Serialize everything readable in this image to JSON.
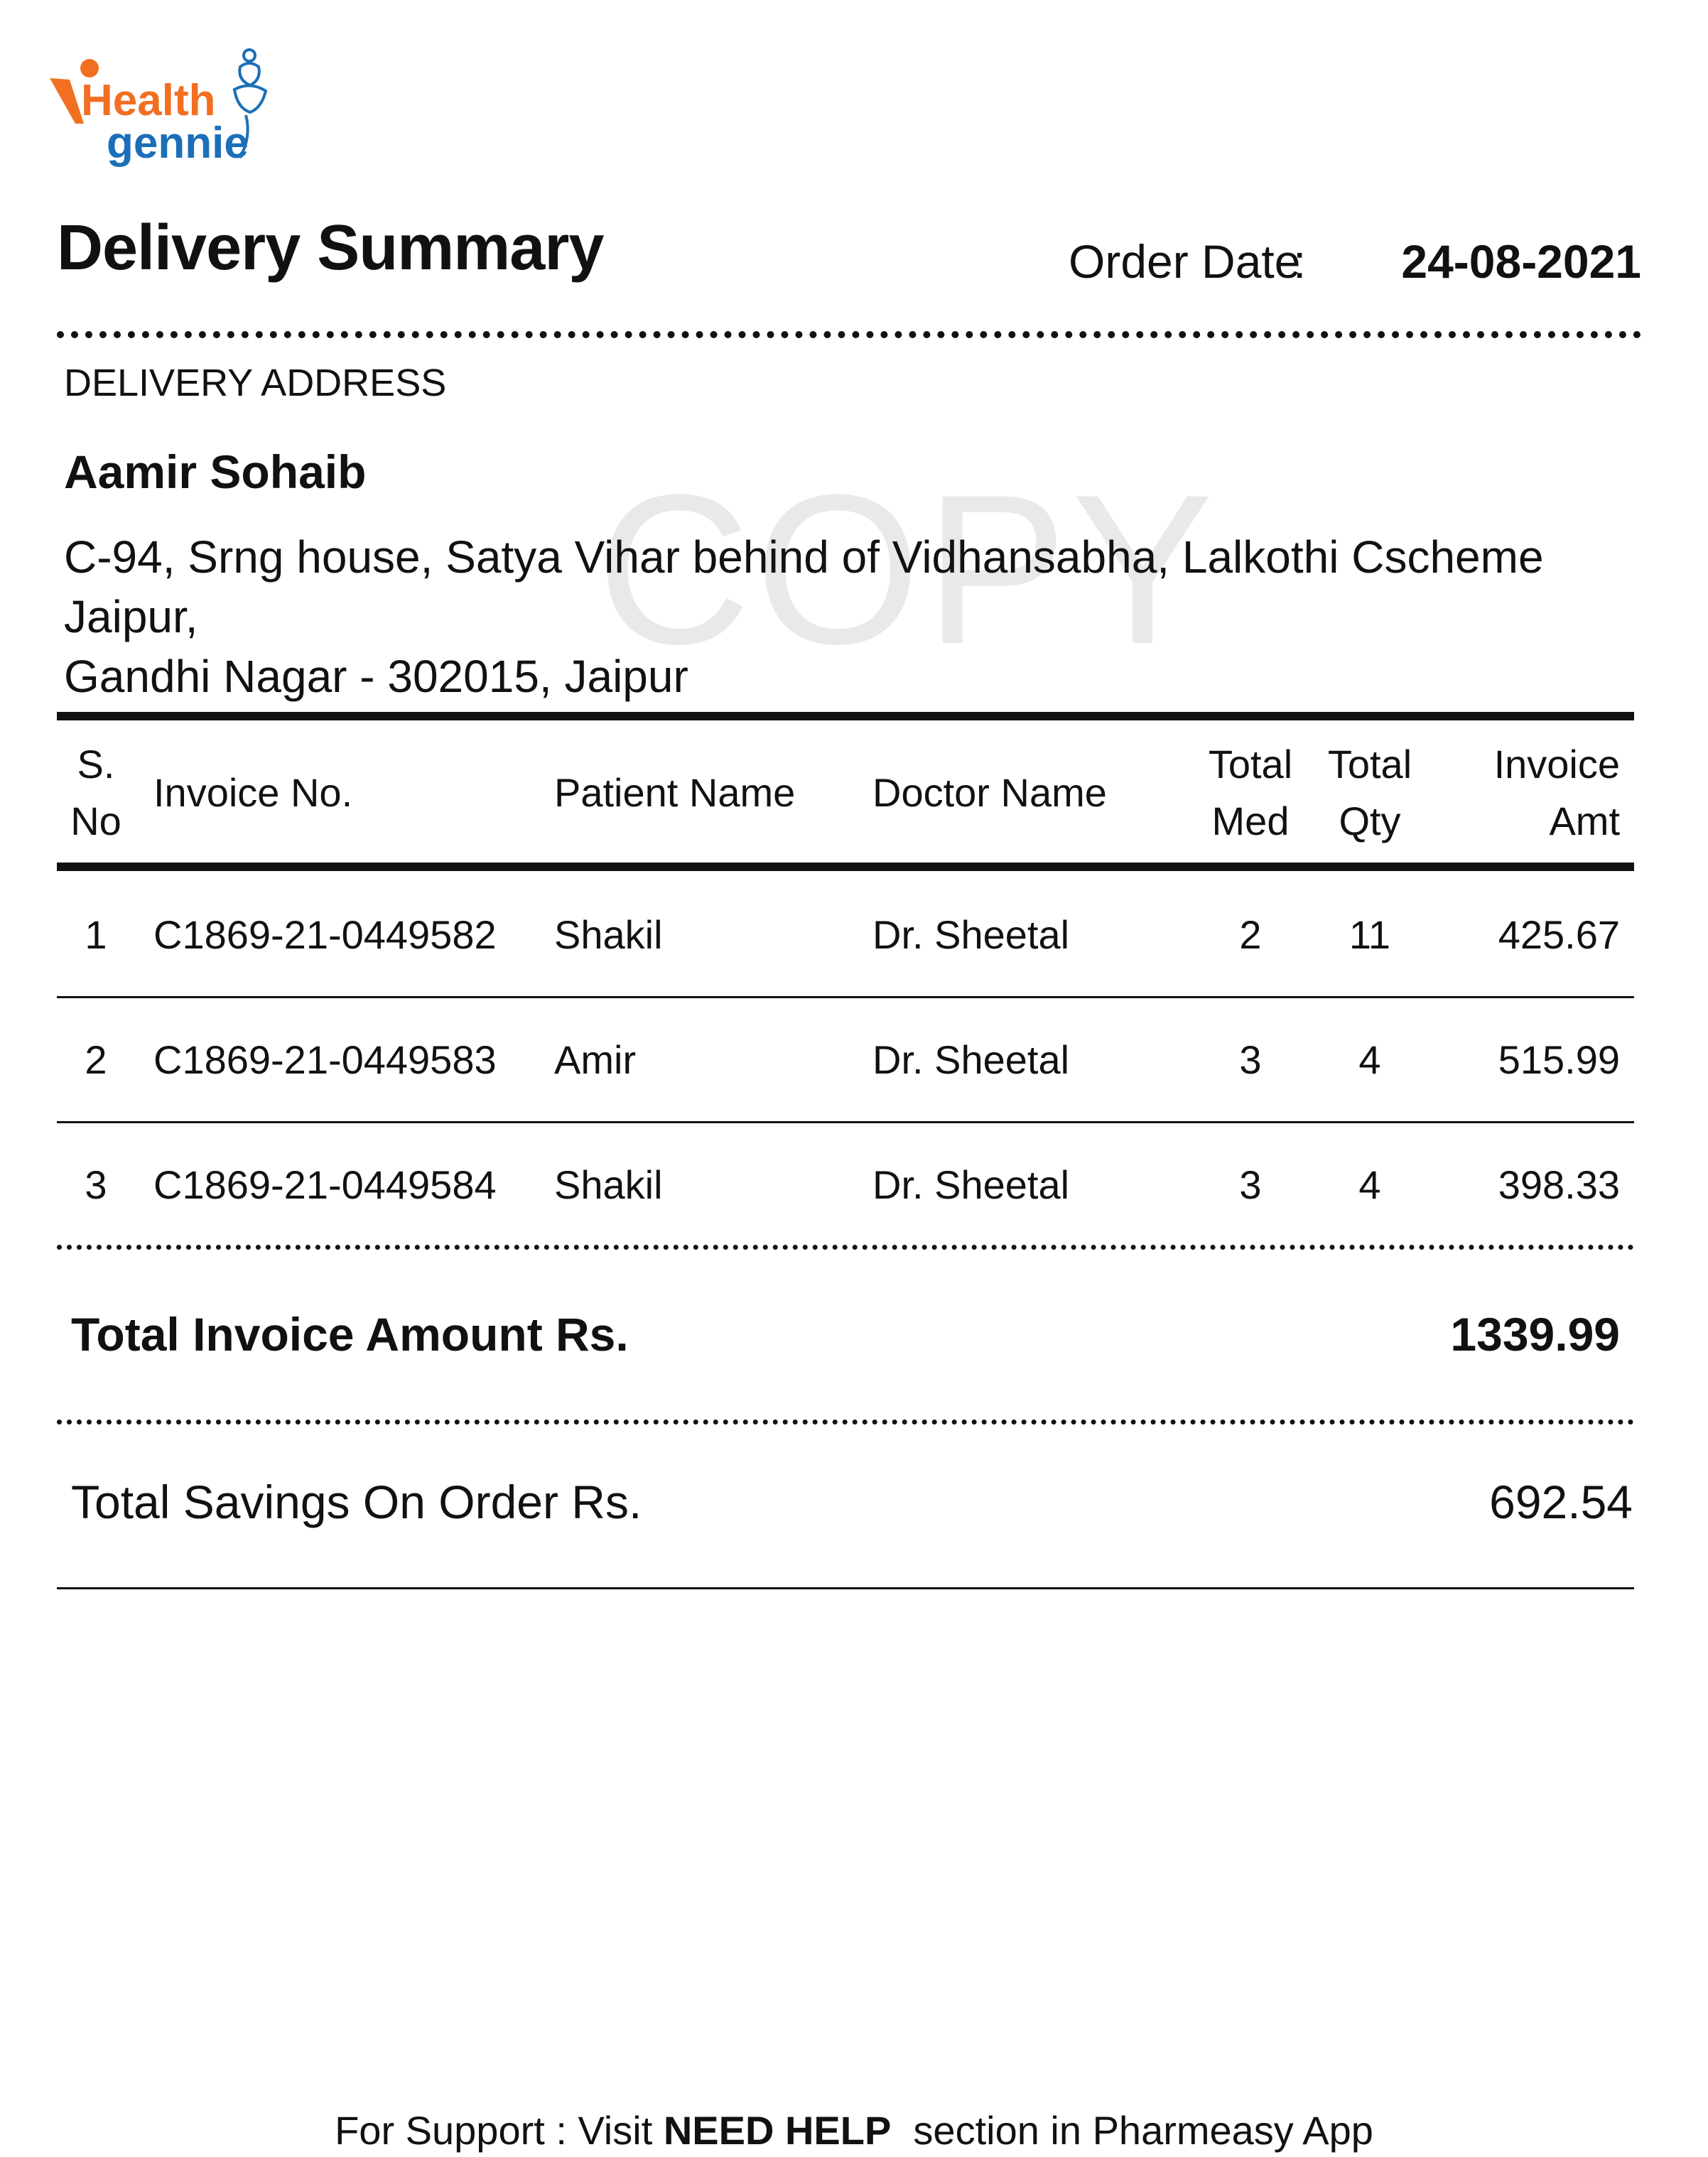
{
  "logo": {
    "line1": "Health",
    "line2": "gennie",
    "orange": "#f26f22",
    "blue": "#1b6fb8"
  },
  "header": {
    "title": "Delivery Summary",
    "order_date_label": "Order Date",
    "colon": ":",
    "order_date": "24-08-2021"
  },
  "address": {
    "label": "DELIVERY ADDRESS",
    "name": "Aamir Sohaib",
    "line1": "C-94, Srng house, Satya Vihar behind of Vidhansabha, Lalkothi Cscheme Jaipur,",
    "line2": "Gandhi Nagar - 302015, Jaipur"
  },
  "watermark": "COPY",
  "table": {
    "headers": {
      "sno": [
        "S.",
        "No"
      ],
      "invoice": "Invoice No.",
      "patient": "Patient Name",
      "doctor": "Doctor Name",
      "med": [
        "Total",
        "Med"
      ],
      "qty": [
        "Total",
        "Qty"
      ],
      "amt": [
        "Invoice",
        "Amt"
      ]
    },
    "rows": [
      {
        "sno": "1",
        "invoice": "C1869-21-0449582",
        "patient": "Shakil",
        "doctor": "Dr. Sheetal",
        "med": "2",
        "qty": "11",
        "amt": "425.67"
      },
      {
        "sno": "2",
        "invoice": "C1869-21-0449583",
        "patient": "Amir",
        "doctor": "Dr. Sheetal",
        "med": "3",
        "qty": "4",
        "amt": "515.99"
      },
      {
        "sno": "3",
        "invoice": "C1869-21-0449584",
        "patient": "Shakil",
        "doctor": "Dr. Sheetal",
        "med": "3",
        "qty": "4",
        "amt": "398.33"
      }
    ]
  },
  "totals": {
    "invoice_label": "Total Invoice Amount Rs.",
    "invoice_value": "1339.99",
    "savings_label": "Total Savings On Order Rs.",
    "savings_value": "692.54"
  },
  "footer": {
    "prefix": "For Support : Visit ",
    "bold": "NEED HELP",
    "suffix": "  section in Pharmeasy App"
  }
}
